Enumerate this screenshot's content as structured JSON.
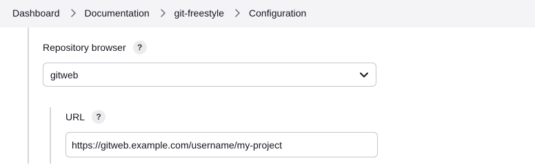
{
  "breadcrumb": {
    "items": [
      {
        "label": "Dashboard"
      },
      {
        "label": "Documentation"
      },
      {
        "label": "git-freestyle"
      },
      {
        "label": "Configuration"
      }
    ]
  },
  "repository_browser": {
    "label": "Repository browser",
    "help": "?",
    "selected": "gitweb",
    "chevron_icon": "chevron-down-icon"
  },
  "url_field": {
    "label": "URL",
    "help": "?",
    "value": "https://gitweb.example.com/username/my-project"
  }
}
